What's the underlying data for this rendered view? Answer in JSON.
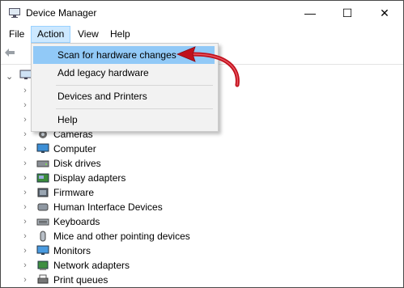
{
  "window": {
    "title": "Device Manager",
    "minimize_glyph": "—",
    "maximize_glyph": "☐",
    "close_glyph": "✕"
  },
  "menu": {
    "items": [
      "File",
      "Action",
      "View",
      "Help"
    ],
    "active": "Action"
  },
  "action_menu": {
    "items": [
      "Scan for hardware changes",
      "Add legacy hardware",
      "Devices and Printers",
      "Help"
    ],
    "highlighted": "Scan for hardware changes"
  },
  "tree": {
    "items": [
      {
        "label": "Cameras",
        "icon": "camera-icon"
      },
      {
        "label": "Computer",
        "icon": "computer-icon"
      },
      {
        "label": "Disk drives",
        "icon": "disk-drive-icon"
      },
      {
        "label": "Display adapters",
        "icon": "display-adapter-icon"
      },
      {
        "label": "Firmware",
        "icon": "firmware-icon"
      },
      {
        "label": "Human Interface Devices",
        "icon": "hid-icon"
      },
      {
        "label": "Keyboards",
        "icon": "keyboard-icon"
      },
      {
        "label": "Mice and other pointing devices",
        "icon": "mouse-icon"
      },
      {
        "label": "Monitors",
        "icon": "monitor-icon"
      },
      {
        "label": "Network adapters",
        "icon": "network-adapter-icon"
      },
      {
        "label": "Print queues",
        "icon": "printer-icon"
      }
    ]
  },
  "colors": {
    "accent_arrow": "#c0101c",
    "menu_highlight": "#91c9f7",
    "menu_active": "#cce8ff"
  }
}
